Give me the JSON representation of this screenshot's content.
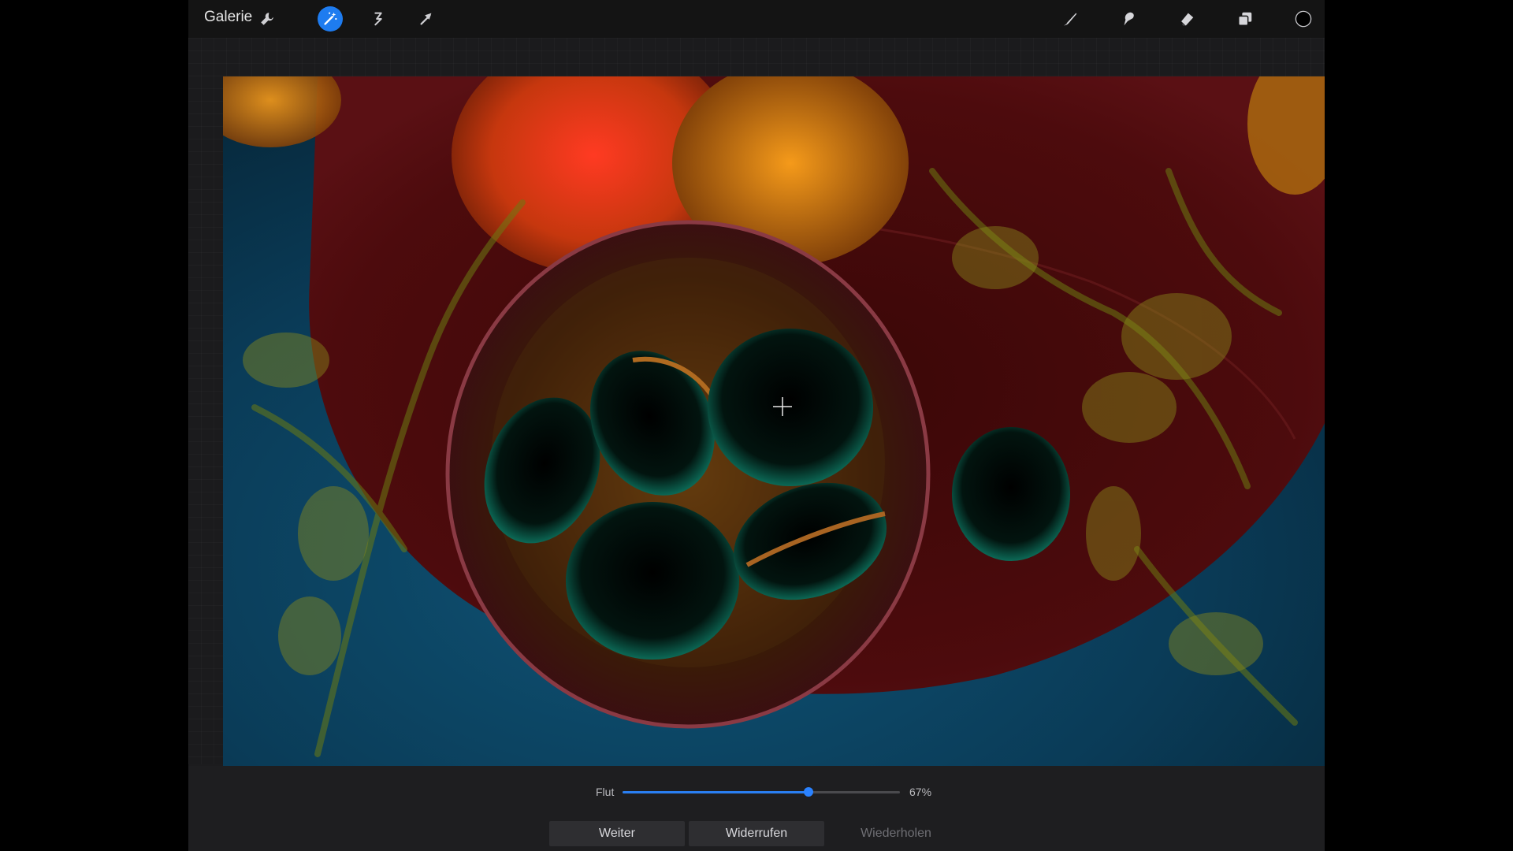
{
  "topbar": {
    "gallery_label": "Galerie",
    "left_tools": [
      {
        "icon": "wrench-icon",
        "active": false
      },
      {
        "icon": "magic-wand-icon",
        "active": true
      },
      {
        "icon": "s-curve-icon",
        "active": false
      },
      {
        "icon": "arrow-icon",
        "active": false
      }
    ],
    "right_tools": [
      {
        "icon": "brush-icon"
      },
      {
        "icon": "smudge-icon"
      },
      {
        "icon": "eraser-icon"
      },
      {
        "icon": "layers-icon"
      },
      {
        "icon": "color-swatch-icon"
      }
    ],
    "active_color": "#1e7cf0",
    "selected_color": "#000000"
  },
  "canvas": {
    "content": "macarons-photo",
    "crosshair_icon": "crosshair-icon"
  },
  "controls": {
    "flut_label": "Flut",
    "flut_value_text": "67%",
    "flut_value": 67,
    "accent": "#2a7ff2"
  },
  "buttons": {
    "weiter_label": "Weiter",
    "widerrufen_label": "Widerrufen",
    "wiederholen_label": "Wiederholen"
  }
}
